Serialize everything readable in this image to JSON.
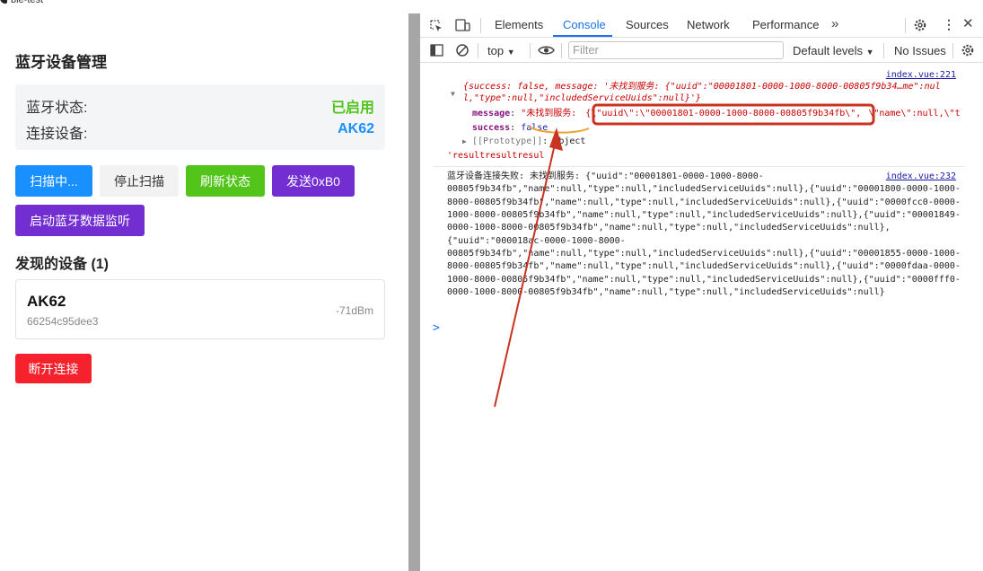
{
  "window": {
    "title": "ble-test"
  },
  "app": {
    "title": "蓝牙设备管理",
    "status": {
      "bluetooth_label": "蓝牙状态:",
      "bluetooth_value": "已启用",
      "device_label": "连接设备:",
      "device_value": "AK62"
    },
    "buttons": {
      "scan": "扫描中...",
      "stop_scan": "停止扫描",
      "refresh": "刷新状态",
      "send": "发送0xB0",
      "monitor": "启动蓝牙数据监听",
      "disconnect": "断开连接"
    },
    "found_title": "发现的设备 (1)",
    "device": {
      "name": "AK62",
      "id": "66254c95dee3",
      "rssi": "-71dBm"
    }
  },
  "devtools": {
    "tabs": [
      "Elements",
      "Console",
      "Sources",
      "Network",
      "Performance"
    ],
    "active_tab": "Console",
    "toolbar": {
      "context": "top",
      "filter_placeholder": "Filter",
      "levels": "Default levels",
      "issues": "No Issues"
    },
    "log1": {
      "source": "index.vue:221",
      "summary1": "{success: false, message: '未找到服务: {\"uuid\":\"00001801-0000-1000-8000-00805f9b34…me\":nul",
      "summary2": "l,\"type\":null,\"includedServiceUuids\":null}'}",
      "message_key": "message",
      "message_value_prefix": "\"未找到服务: ",
      "message_value_highlight": "{\\\"uuid\\\":\\\"00001801-0000-1000-8000-00805f9b34fb\\\",",
      "message_value_rest": "\\\"name\\\":null,\\\"t",
      "success_key": "success",
      "success_value": "false",
      "prototype_key": "[[Prototype]]",
      "prototype_value": "Object",
      "tail": "'resultresultresul"
    },
    "log2": {
      "source": "index.vue:232",
      "lines": [
        "蓝牙设备连接失败: 未找到服务: {\"uuid\":\"00001801-0000-1000-8000-",
        "00805f9b34fb\",\"name\":null,\"type\":null,\"includedServiceUuids\":null},{\"uuid\":\"00001800-0000-1000-",
        "8000-00805f9b34fb\",\"name\":null,\"type\":null,\"includedServiceUuids\":null},{\"uuid\":\"0000fcc0-0000-",
        "1000-8000-00805f9b34fb\",\"name\":null,\"type\":null,\"includedServiceUuids\":null},{\"uuid\":\"00001849-",
        "0000-1000-8000-00805f9b34fb\",\"name\":null,\"type\":null,\"includedServiceUuids\":null},",
        "{\"uuid\":\"000018ac-0000-1000-8000-",
        "00805f9b34fb\",\"name\":null,\"type\":null,\"includedServiceUuids\":null},{\"uuid\":\"00001855-0000-1000-",
        "8000-00805f9b34fb\",\"name\":null,\"type\":null,\"includedServiceUuids\":null},{\"uuid\":\"0000fdaa-0000-",
        "1000-8000-00805f9b34fb\",\"name\":null,\"type\":null,\"includedServiceUuids\":null},{\"uuid\":\"0000fff0-",
        "0000-1000-8000-00805f9b34fb\",\"name\":null,\"type\":null,\"includedServiceUuids\":null}"
      ]
    },
    "prompt": ">"
  },
  "annotation_color": "#c9331f"
}
